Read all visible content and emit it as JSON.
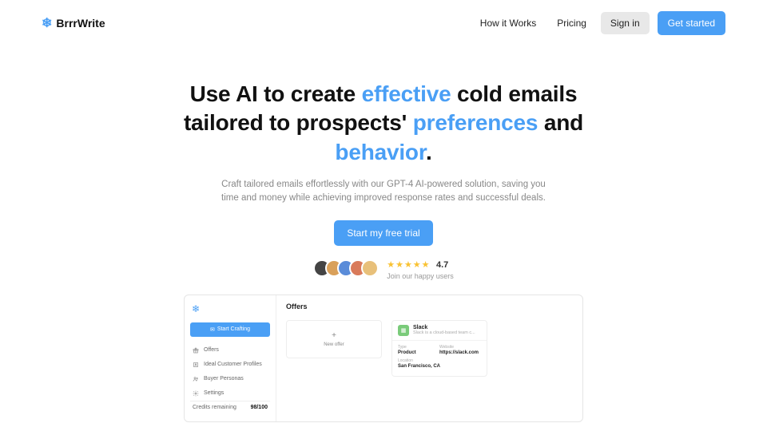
{
  "brand": "BrrrWrite",
  "nav": {
    "how": "How it Works",
    "pricing": "Pricing",
    "signin": "Sign in",
    "getstarted": "Get started"
  },
  "hero": {
    "t1": "Use AI to create ",
    "a1": "effective",
    "t2": " cold emails tailored to prospects' ",
    "a2": "preferences",
    "t3": " and ",
    "a3": "behavior",
    "t4": ".",
    "sub": "Craft tailored emails effortlessly with our GPT-4 AI-powered solution, saving you time and money while achieving improved response rates and successful deals.",
    "cta": "Start my free trial"
  },
  "rating": {
    "stars": "★★★★★",
    "score": "4.7",
    "sub": "Join our happy users"
  },
  "demo": {
    "start_crafting": "Start Crafting",
    "sidebar": {
      "offers": "Offers",
      "icp": "Ideal Customer Profiles",
      "personas": "Buyer Personas",
      "settings": "Settings"
    },
    "credits_label": "Credits remaining",
    "credits_value": "98/100",
    "main_title": "Offers",
    "new_offer": "New offer",
    "offer": {
      "name": "Slack",
      "desc": "Slack is a cloud-based team c...",
      "type_label": "Type",
      "type_value": "Product",
      "website_label": "Website",
      "website_value": "https://slack.com",
      "location_label": "Location",
      "location_value": "San Francisco, CA"
    }
  }
}
